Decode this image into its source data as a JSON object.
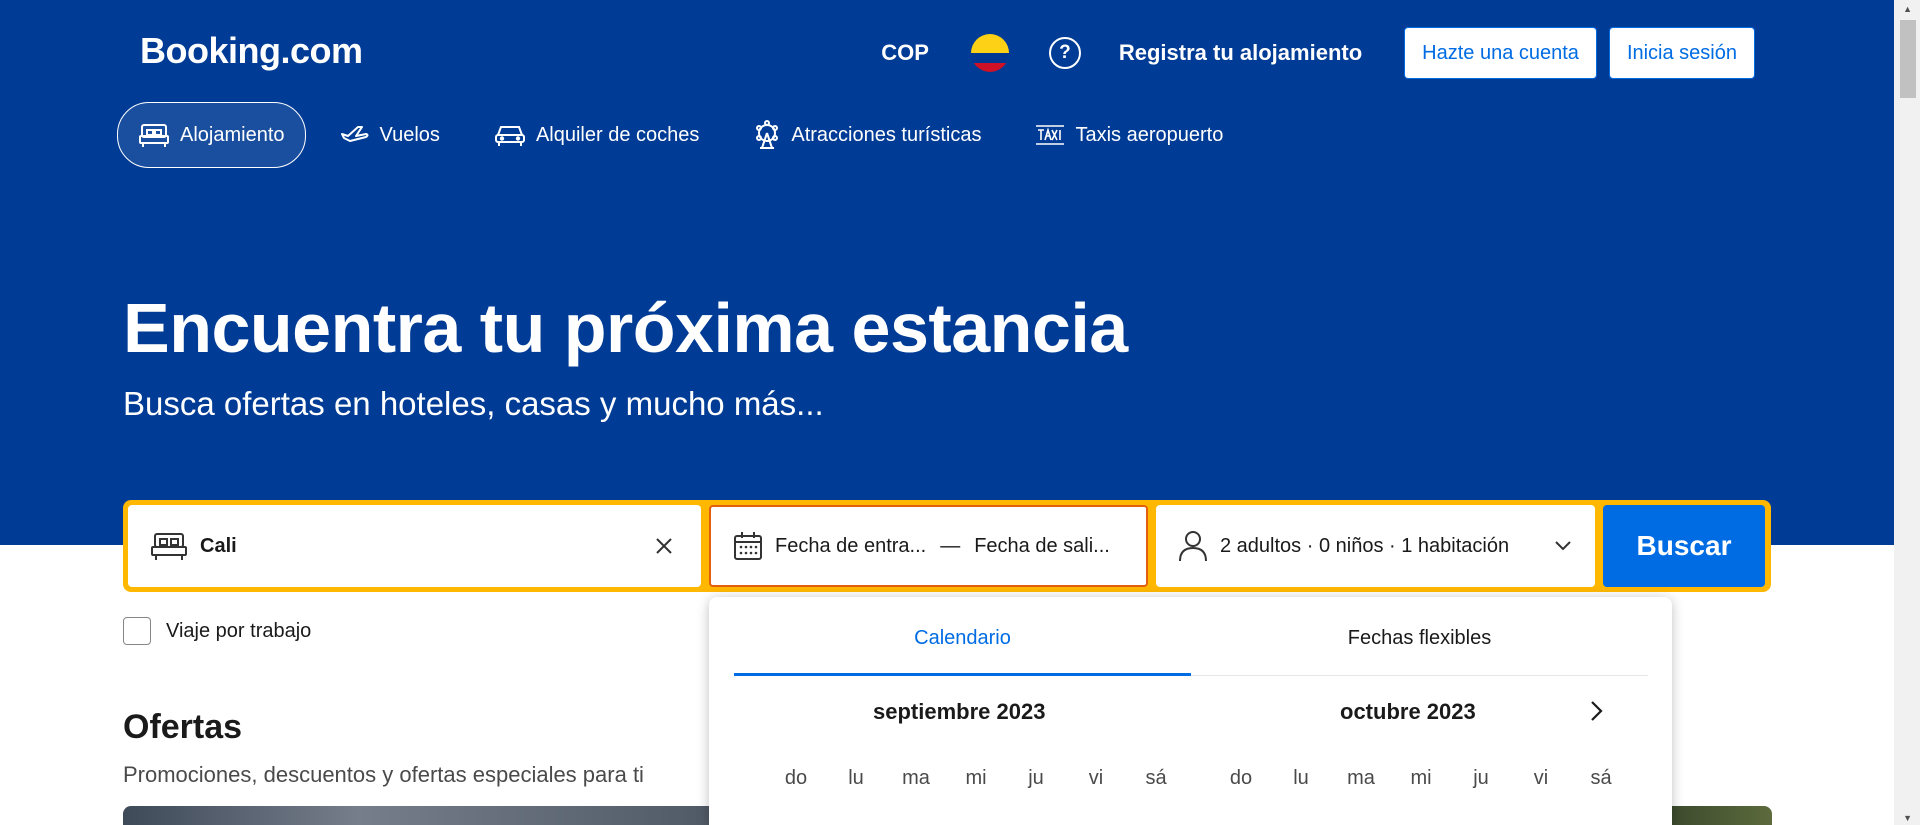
{
  "header": {
    "logo": "Booking.com",
    "currency": "COP",
    "flag_icon": "colombia-flag-icon",
    "help_glyph": "?",
    "list_property": "Registra tu alojamiento",
    "register_button": "Hazte una cuenta",
    "signin_button": "Inicia sesión"
  },
  "nav": {
    "items": [
      {
        "label": "Alojamiento",
        "icon": "bed-icon",
        "active": true
      },
      {
        "label": "Vuelos",
        "icon": "plane-icon"
      },
      {
        "label": "Alquiler de coches",
        "icon": "car-icon"
      },
      {
        "label": "Atracciones turísticas",
        "icon": "attractions-icon"
      },
      {
        "label": "Taxis aeropuerto",
        "icon": "taxi-icon"
      }
    ]
  },
  "hero": {
    "title": "Encuentra tu próxima estancia",
    "subtitle": "Busca ofertas en hoteles, casas y mucho más..."
  },
  "search": {
    "destination_value": "Cali",
    "checkin": "Fecha de entra...",
    "date_separator": "—",
    "checkout": "Fecha de sali...",
    "occupancy": "2 adultos · 0 niños · 1 habitación",
    "search_button": "Buscar",
    "work_trip_label": "Viaje por trabajo",
    "work_trip_checked": false
  },
  "offers": {
    "title": "Ofertas",
    "subtitle": "Promociones, descuentos y ofertas especiales para ti"
  },
  "calendar": {
    "tabs": [
      {
        "label": "Calendario",
        "active": true
      },
      {
        "label": "Fechas flexibles",
        "active": false
      }
    ],
    "months": [
      "septiembre 2023",
      "octubre 2023"
    ],
    "weekdays": [
      "do",
      "lu",
      "ma",
      "mi",
      "ju",
      "vi",
      "sá"
    ]
  },
  "colors": {
    "brand_blue": "#003b95",
    "action_blue": "#006ce4",
    "search_border": "#ffb700",
    "active_field_border": "#e15f0e"
  }
}
